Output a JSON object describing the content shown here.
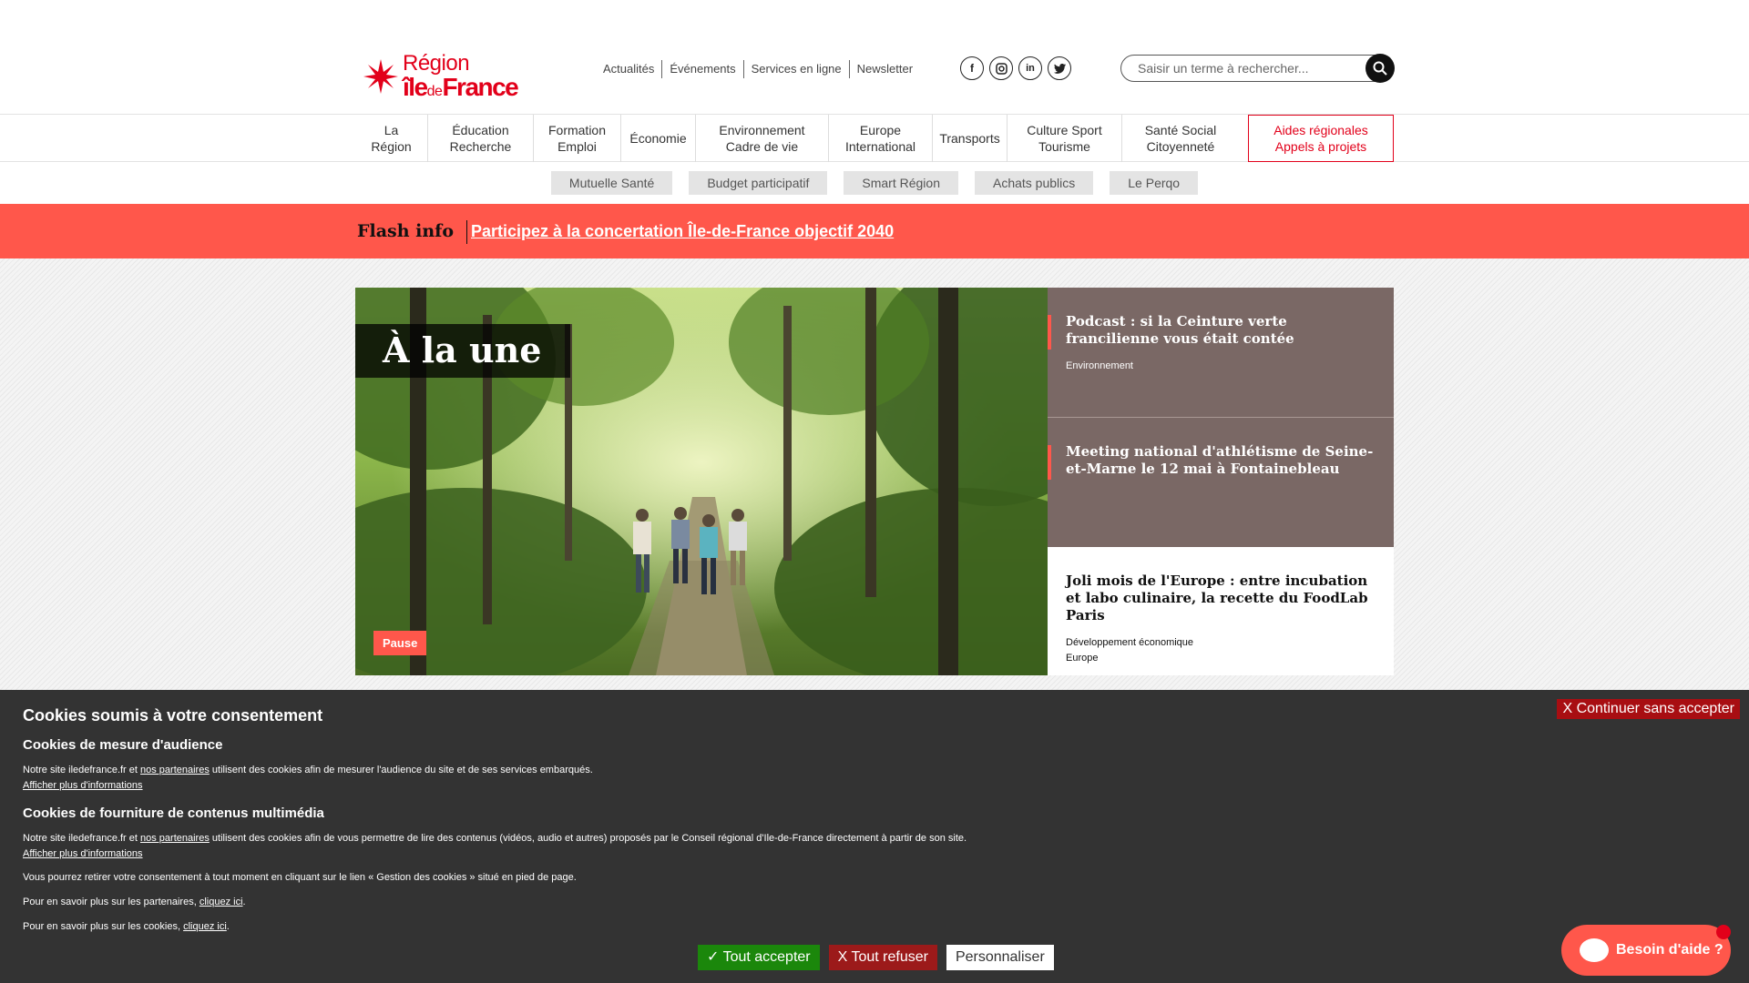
{
  "header": {
    "logo_line1": "Région",
    "logo_line2_a": "île",
    "logo_line2_b": "de",
    "logo_line2_c": "France",
    "top_links": [
      "Actualités",
      "Événements",
      "Services en ligne",
      "Newsletter"
    ],
    "social_icons": [
      "facebook-icon",
      "instagram-icon",
      "linkedin-icon",
      "twitter-icon"
    ],
    "search_placeholder": "Saisir un terme à rechercher..."
  },
  "main_nav": {
    "items": [
      {
        "line1": "La Région",
        "line2": ""
      },
      {
        "line1": "Éducation",
        "line2": "Recherche"
      },
      {
        "line1": "Formation",
        "line2": "Emploi"
      },
      {
        "line1": "Économie",
        "line2": ""
      },
      {
        "line1": "Environnement",
        "line2": "Cadre de vie"
      },
      {
        "line1": "Europe",
        "line2": "International"
      },
      {
        "line1": "Transports",
        "line2": ""
      },
      {
        "line1": "Culture Sport",
        "line2": "Tourisme"
      },
      {
        "line1": "Santé Social",
        "line2": "Citoyenneté"
      }
    ],
    "aides_line1": "Aides régionales",
    "aides_line2": "Appels à projets",
    "accent_color": "#e2001a"
  },
  "sub_nav": [
    "Mutuelle Santé",
    "Budget participatif",
    "Smart Région",
    "Achats publics",
    "Le Perqo"
  ],
  "flash": {
    "label": "Flash info",
    "link": "Participez à la concertation Île-de-France objectif 2040",
    "color": "#ff574b"
  },
  "hero": {
    "title": "À la une",
    "tag": "Pause"
  },
  "news": [
    {
      "title": "Podcast : si la Ceinture verte francilienne vous était contée",
      "categories": [
        "Environnement"
      ]
    },
    {
      "title": "Meeting national d'athlétisme de Seine-et-Marne le 12 mai à Fontainebleau",
      "categories": []
    },
    {
      "title": "Joli mois de l'Europe : entre incubation et labo culinaire, la recette du FoodLab Paris",
      "categories": [
        "Développement économique",
        "Europe"
      ]
    }
  ],
  "cookie": {
    "title": "Cookies soumis à votre consentement",
    "continue": "X Continuer sans accepter",
    "audience_title": "Cookies de mesure d'audience",
    "audience_text_a": "Notre site iledefrance.fr et ",
    "partners_link": "nos partenaires",
    "audience_text_b": " utilisent des cookies afin de mesurer l'audience du site et de ses services embarqués.",
    "more_info": "Afficher plus d'informations",
    "media_title": "Cookies de fourniture de contenus multimédia",
    "media_text_a": "Notre site iledefrance.fr et ",
    "media_text_b": " utilisent des cookies afin de vous permettre de lire des contenus (vidéos, audio et autres) proposés par le Conseil régional d'Ile-de-France directement à partir de son site.",
    "withdraw_text": "Vous pourrez retirer votre consentement à tout moment en cliquant sur le lien « Gestion des cookies » situé en pied de page.",
    "partners_more_a": "Pour en savoir plus sur les partenaires, ",
    "cookies_more_a": "Pour en savoir plus sur les cookies, ",
    "click_here": "cliquez ici",
    "period": ".",
    "accept": "✓ Tout accepter",
    "refuse": "X Tout refuser",
    "customize": "Personnaliser"
  },
  "help": {
    "label": "Besoin d'aide ?"
  }
}
